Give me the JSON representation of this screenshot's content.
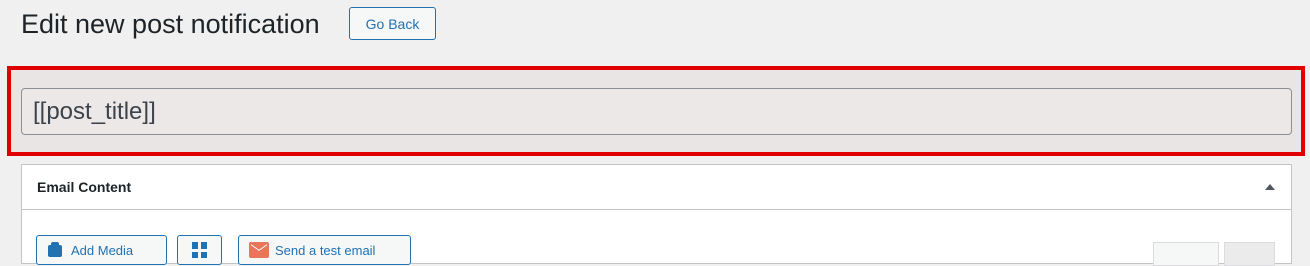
{
  "header": {
    "title": "Edit new post notification",
    "go_back_label": "Go Back"
  },
  "subject": {
    "value": "[[post_title]]"
  },
  "email_content": {
    "title": "Email Content",
    "toolbar": {
      "add_media_label": "Add Media",
      "send_test_label": "Send a test email"
    }
  },
  "colors": {
    "highlight": "#e00000",
    "accent": "#2271b1"
  }
}
